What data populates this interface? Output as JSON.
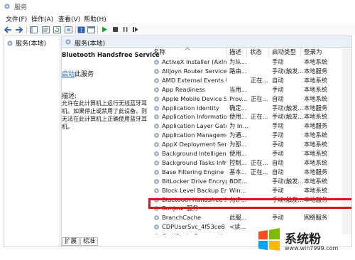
{
  "window": {
    "title": "服务"
  },
  "menu": [
    {
      "label": "文件(F)"
    },
    {
      "label": "操作(A)"
    },
    {
      "label": "查看(V)"
    },
    {
      "label": "帮助(H)"
    }
  ],
  "tree": {
    "root_label": "服务(本地)"
  },
  "header": {
    "title": "服务(本地)"
  },
  "detail": {
    "service_name": "Bluetooth Handsfree Service",
    "start_link": "启动",
    "start_suffix": "此服务",
    "desc_label": "描述:",
    "desc_text": "允许在此计算机上运行无线蓝牙耳机。如果停止或禁用了此设备，则无法在此计算机上正确使用蓝牙耳机。"
  },
  "columns": [
    "名称",
    "描述",
    "状态",
    "启动类型",
    "登录为"
  ],
  "rows": [
    {
      "name": "ActiveX Installer (AxInstSV)",
      "desc": "为从...",
      "status": "",
      "startup": "手动",
      "logon": "本地系统"
    },
    {
      "name": "AllJoyn Router Service",
      "desc": "路由...",
      "status": "",
      "startup": "手动(触发...",
      "logon": "本地服务"
    },
    {
      "name": "AMD External Events Utility",
      "desc": "",
      "status": "正在...",
      "startup": "自动",
      "logon": "本地系统"
    },
    {
      "name": "App Readiness",
      "desc": "当用...",
      "status": "",
      "startup": "手动",
      "logon": "本地系统"
    },
    {
      "name": "Apple Mobile Device Service",
      "desc": "Prov...",
      "status": "正在...",
      "startup": "自动",
      "logon": "本地系统"
    },
    {
      "name": "Application Identity",
      "desc": "确定...",
      "status": "",
      "startup": "手动(触发...",
      "logon": "本地服务"
    },
    {
      "name": "Application Information",
      "desc": "使用...",
      "status": "正在...",
      "startup": "手动(触发...",
      "logon": "本地系统"
    },
    {
      "name": "Application Layer Gatewa...",
      "desc": "为 In...",
      "status": "",
      "startup": "手动",
      "logon": "本地服务"
    },
    {
      "name": "Application Management",
      "desc": "为通...",
      "status": "",
      "startup": "手动",
      "logon": "本地系统"
    },
    {
      "name": "AppX Deployment Servic...",
      "desc": "为部...",
      "status": "",
      "startup": "手动",
      "logon": "本地系统"
    },
    {
      "name": "Background Intelligent T...",
      "desc": "使用...",
      "status": "",
      "startup": "手动",
      "logon": "本地系统"
    },
    {
      "name": "Background Tasks Infra...",
      "desc": "控制...",
      "status": "正在...",
      "startup": "自动",
      "logon": "本地系统"
    },
    {
      "name": "Base Filtering Engine",
      "desc": "基本...",
      "status": "正在...",
      "startup": "自动",
      "logon": "本地服务"
    },
    {
      "name": "BitLocker Drive Encryptio...",
      "desc": "BDE...",
      "status": "",
      "startup": "手动(触发...",
      "logon": "本地系统"
    },
    {
      "name": "Block Level Backup Engi...",
      "desc": "Win...",
      "status": "",
      "startup": "手动",
      "logon": "本地系统"
    },
    {
      "name": "Bluetooth Handsfree Ser...",
      "desc": "允许...",
      "status": "",
      "startup": "手动(触发...",
      "logon": "本地服务"
    },
    {
      "name": "Bonjour 服务",
      "desc": "",
      "status": "",
      "startup": "",
      "logon": ""
    },
    {
      "name": "BranchCache",
      "desc": "此服...",
      "status": "",
      "startup": "手动",
      "logon": "网络服务"
    },
    {
      "name": "CDPUserSvc_4f53ce6",
      "desc": "<读...",
      "status": "",
      "startup": "",
      "logon": ""
    },
    {
      "name": "Certificate Propagation",
      "desc": "",
      "status": "",
      "startup": "",
      "logon": ""
    }
  ],
  "tabs": [
    {
      "label": "扩展"
    },
    {
      "label": "标准"
    }
  ],
  "watermark": {
    "brand": "系统粉",
    "url": "www.win7999.com"
  },
  "colors": {
    "selection_box": "#e0101a",
    "play_green": "#1f9e3a",
    "link_blue": "#1a5fb4"
  }
}
